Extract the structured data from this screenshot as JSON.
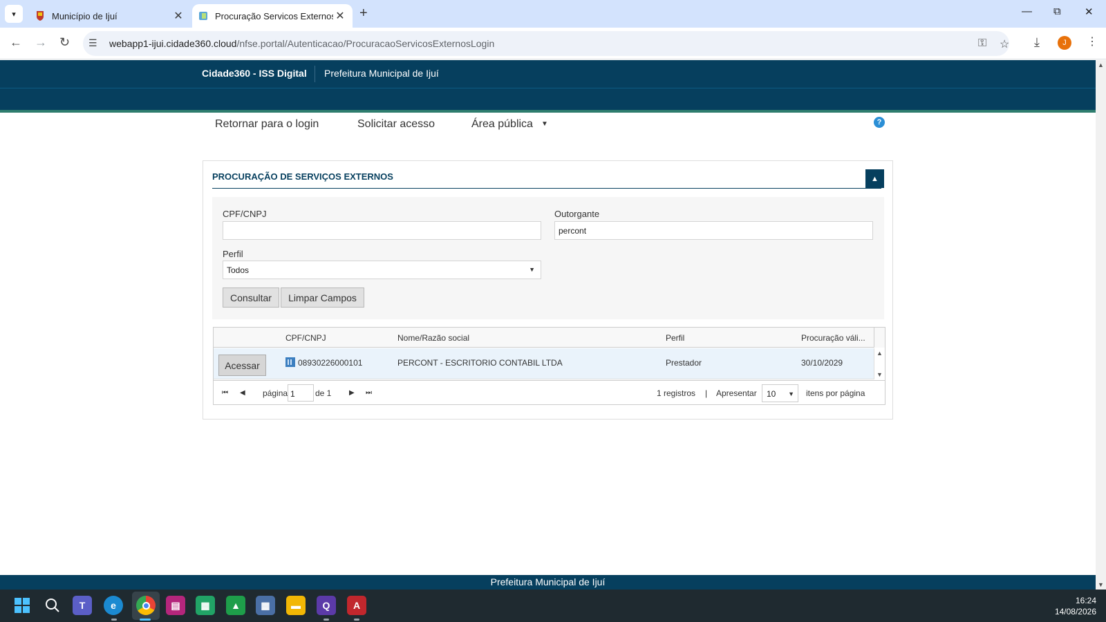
{
  "browser": {
    "tabs": [
      {
        "title": "Município de Ijuí",
        "active": false,
        "favicon": "crest-icon"
      },
      {
        "title": "Procuração Servicos Externos",
        "active": true,
        "favicon": "page-icon"
      }
    ],
    "url_domain": "webapp1-ijui.cidade360.cloud",
    "url_path": "/nfse.portal/Autenticacao/ProcuracaoServicosExternosLogin",
    "profile_initial": "J"
  },
  "header": {
    "brand": "Cidade360 - ISS Digital",
    "prefeitura": "Prefeitura Municipal de Ijuí",
    "help": "?"
  },
  "menu": {
    "retornar": "Retornar para o login",
    "solicitar": "Solicitar acesso",
    "area_publica": "Área pública"
  },
  "panel": {
    "title": "PROCURAÇÃO DE SERVIÇOS EXTERNOS",
    "form": {
      "cpf_label": "CPF/CNPJ",
      "cpf_value": "",
      "outorgante_label": "Outorgante",
      "outorgante_value": "percont",
      "perfil_label": "Perfil",
      "perfil_value": "Todos",
      "consultar": "Consultar",
      "limpar": "Limpar Campos"
    },
    "grid": {
      "columns": [
        "CPF/CNPJ",
        "Nome/Razão social",
        "Perfil",
        "Procuração váli..."
      ],
      "rows": [
        {
          "action": "Acessar",
          "cpf": "08930226000101",
          "nome": "PERCONT - ESCRITORIO CONTABIL LTDA",
          "perfil": "Prestador",
          "validade": "30/10/2029"
        }
      ],
      "pager": {
        "pagina_label": "página",
        "page": "1",
        "de_label": "de 1",
        "registros": "1 registros",
        "separator": "|",
        "apresentar": "Apresentar",
        "page_size": "10",
        "itens": "itens por página"
      }
    }
  },
  "footer": "Prefeitura Municipal de Ijuí",
  "taskbar": {
    "apps": [
      "windows-start-icon",
      "search-icon",
      "teams-icon",
      "edge-icon",
      "chrome-icon",
      "onenote-icon",
      "calculator-sheet-icon",
      "app-green-icon",
      "calculator-icon",
      "file-explorer-icon",
      "app-purple-icon",
      "acrobat-icon"
    ],
    "time": "16:24",
    "date": "14/08/2026"
  },
  "colors": {
    "header": "#063f5e",
    "stripe": "#2e7d6e",
    "row_highlight": "#eaf3fb"
  }
}
